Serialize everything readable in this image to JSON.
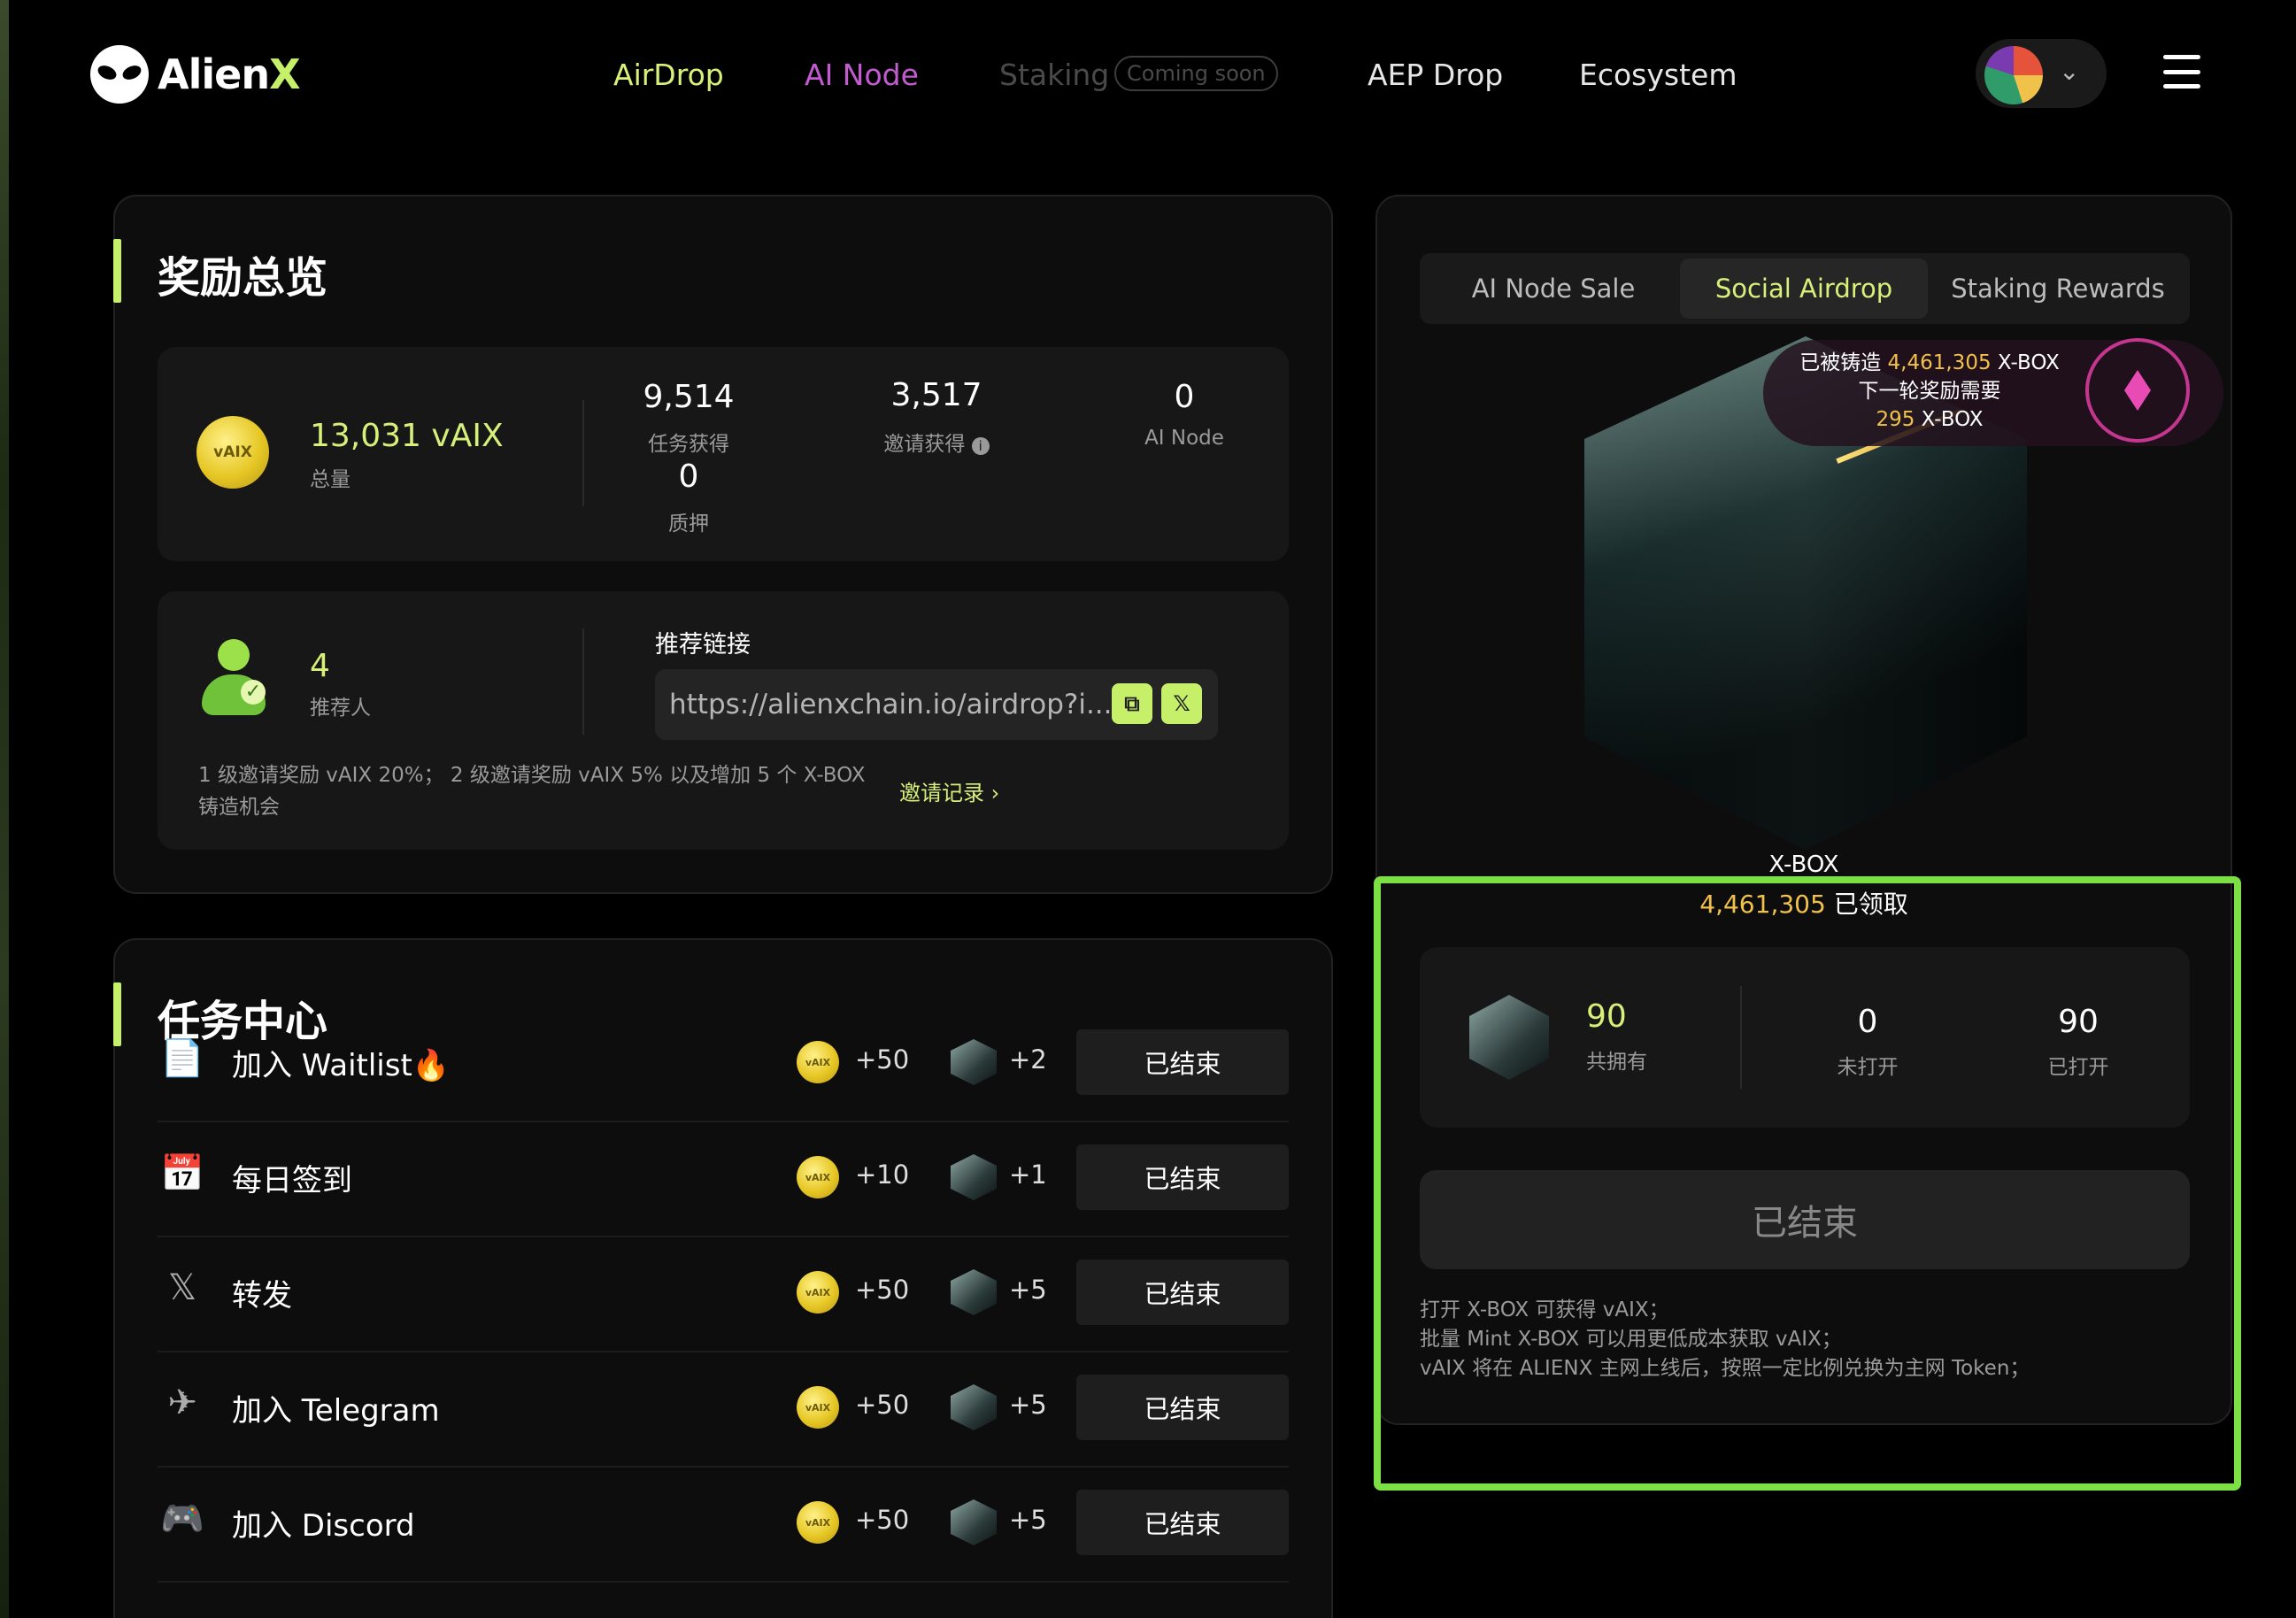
{
  "header": {
    "logo_text_main": "Alien",
    "logo_text_x": "X",
    "nav": {
      "airdrop": "AirDrop",
      "ainode": "AI Node",
      "staking": "Staking",
      "staking_badge": "Coming soon",
      "aep": "AEP Drop",
      "ecosystem": "Ecosystem"
    }
  },
  "reward": {
    "title": "奖励总览",
    "total_value": "13,031 vAIX",
    "total_label": "总量",
    "coin_text": "vAIX",
    "task_value": "9,514",
    "task_label": "任务获得",
    "invite_value": "3,517",
    "invite_label": "邀请获得",
    "ainode_value": "0",
    "ainode_label": "AI Node",
    "stake_value": "0",
    "stake_label": "质押",
    "referrer_count": "4",
    "referrer_label": "推荐人",
    "link_title": "推荐链接",
    "link_url": "https://alienxchain.io/airdrop?i...",
    "copy_icon": "⧉",
    "x_icon": "𝕏",
    "invite_note": "1 级邀请奖励 vAIX 20%； 2 级邀请奖励 vAIX 5% 以及增加 5 个 X-BOX 铸造机会",
    "invite_record": "邀请记录 ›"
  },
  "tasks": {
    "title": "任务中心",
    "items": [
      {
        "name": "加入 Waitlist",
        "emoji": "🔥",
        "icon": "📄",
        "vaix": "+50",
        "box": "+2",
        "btn": "已结束"
      },
      {
        "name": "每日签到",
        "emoji": "",
        "icon": "📅",
        "vaix": "+10",
        "box": "+1",
        "btn": "已结束"
      },
      {
        "name": "转发",
        "emoji": "",
        "icon": "𝕏",
        "vaix": "+50",
        "box": "+5",
        "btn": "已结束"
      },
      {
        "name": "加入 Telegram",
        "emoji": "",
        "icon": "✈",
        "vaix": "+50",
        "box": "+5",
        "btn": "已结束"
      },
      {
        "name": "加入 Discord",
        "emoji": "",
        "icon": "🎮",
        "vaix": "+50",
        "box": "+5",
        "btn": "已结束"
      }
    ]
  },
  "right": {
    "tabs": [
      "AI Node Sale",
      "Social Airdrop",
      "Staking Rewards"
    ],
    "minted_prefix": "已被铸造",
    "minted_value": "4,461,305",
    "minted_suffix": "X-BOX",
    "next_line": "下一轮奖励需要",
    "next_value": "295",
    "next_suffix": "X-BOX",
    "xbox_label": "X-BOX",
    "claimed_value": "4,461,305",
    "claimed_label": "已领取",
    "own_value": "90",
    "own_label": "共拥有",
    "unopened_value": "0",
    "unopened_label": "未打开",
    "opened_value": "90",
    "opened_label": "已打开",
    "ended_btn": "已结束",
    "notes": [
      "打开 X-BOX 可获得 vAIX；",
      "批量 Mint X-BOX 可以用更低成本获取 vAIX；",
      "vAIX 将在 ALIENX 主网上线后，按照一定比例兑换为主网 Token；"
    ]
  }
}
